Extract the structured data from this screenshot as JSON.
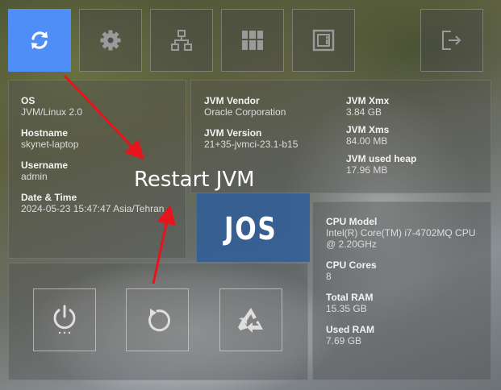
{
  "toolbar": {
    "items": [
      {
        "name": "refresh",
        "icon": "refresh-icon",
        "active": true
      },
      {
        "name": "settings",
        "icon": "gear-icon",
        "active": false
      },
      {
        "name": "network",
        "icon": "sitemap-icon",
        "active": false
      },
      {
        "name": "apps",
        "icon": "grid-icon",
        "active": false
      },
      {
        "name": "chip",
        "icon": "chip-icon",
        "active": false
      },
      {
        "name": "logout",
        "icon": "logout-icon",
        "active": false
      }
    ]
  },
  "system": {
    "os_label": "OS",
    "os_value": "JVM/Linux 2.0",
    "hostname_label": "Hostname",
    "hostname_value": "skynet-laptop",
    "username_label": "Username",
    "username_value": "admin",
    "datetime_label": "Date & Time",
    "datetime_value": "2024-05-23 15:47:47 Asia/Tehran"
  },
  "jvm": {
    "vendor_label": "JVM Vendor",
    "vendor_value": "Oracle Corporation",
    "version_label": "JVM Version",
    "version_value": "21+35-jvmci-23.1-b15",
    "xmx_label": "JVM Xmx",
    "xmx_value": "3.84 GB",
    "xms_label": "JVM Xms",
    "xms_value": "84.00 MB",
    "heap_label": "JVM used heap",
    "heap_value": "17.96 MB"
  },
  "hardware": {
    "cpu_model_label": "CPU Model",
    "cpu_model_value": "Intel(R) Core(TM) i7-4702MQ CPU @ 2.20GHz",
    "cpu_cores_label": "CPU Cores",
    "cpu_cores_value": "8",
    "total_ram_label": "Total RAM",
    "total_ram_value": "15.35 GB",
    "used_ram_label": "Used RAM",
    "used_ram_value": "7.69 GB"
  },
  "brand": {
    "logo_text": "JOS"
  },
  "power": {
    "buttons": [
      {
        "name": "power",
        "icon": "power-icon"
      },
      {
        "name": "restart",
        "icon": "restart-icon"
      },
      {
        "name": "recycle",
        "icon": "recycle-icon"
      }
    ]
  },
  "annotation": {
    "text": "Restart JVM",
    "color": "#e8141c"
  },
  "colors": {
    "accent": "#4f8ef7"
  }
}
